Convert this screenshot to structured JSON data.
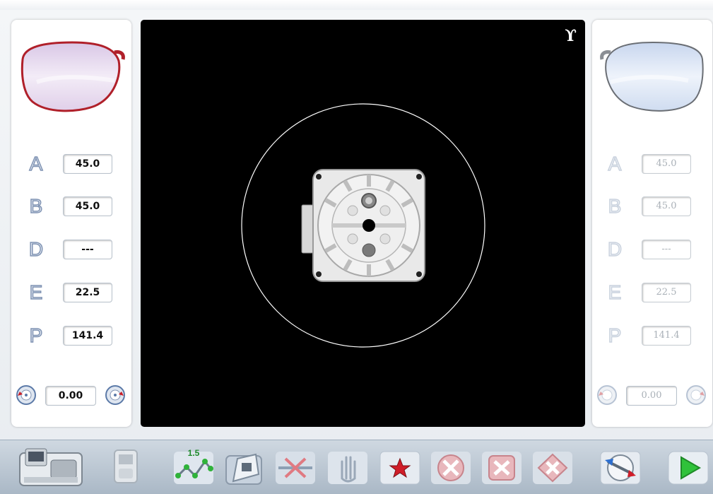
{
  "left_panel": {
    "params": [
      {
        "letter": "A",
        "value": "45.0"
      },
      {
        "letter": "B",
        "value": "45.0"
      },
      {
        "letter": "D",
        "value": "---"
      },
      {
        "letter": "E",
        "value": "22.5"
      },
      {
        "letter": "P",
        "value": "141.4"
      }
    ],
    "rotation_value": "0.00"
  },
  "right_panel": {
    "params": [
      {
        "letter": "A",
        "value": "45.0"
      },
      {
        "letter": "B",
        "value": "45.0"
      },
      {
        "letter": "D",
        "value": "---"
      },
      {
        "letter": "E",
        "value": "22.5"
      },
      {
        "letter": "P",
        "value": "141.4"
      }
    ],
    "rotation_value": "0.00"
  },
  "toolbar": {
    "step_badge": "1.5",
    "icons": [
      "edger-machine-icon",
      "tracer-device-icon",
      "zigzag-graph-icon",
      "block-holder-icon",
      "cross-arrows-icon",
      "hand-icon",
      "star-icon",
      "cancel-red-icon",
      "cancel-red-icon",
      "cancel-red-icon",
      "lens-adjust-icon",
      "play-icon"
    ]
  },
  "colors": {
    "left_frame": "#b0202a",
    "right_frame": "#6a6e74",
    "letter_active": "#7f93b3",
    "letter_inactive": "#c9d2de",
    "camera_bg": "#000000",
    "play_green": "#2fc23a",
    "star_red": "#d01d28"
  },
  "brand_mark": "ϒ"
}
